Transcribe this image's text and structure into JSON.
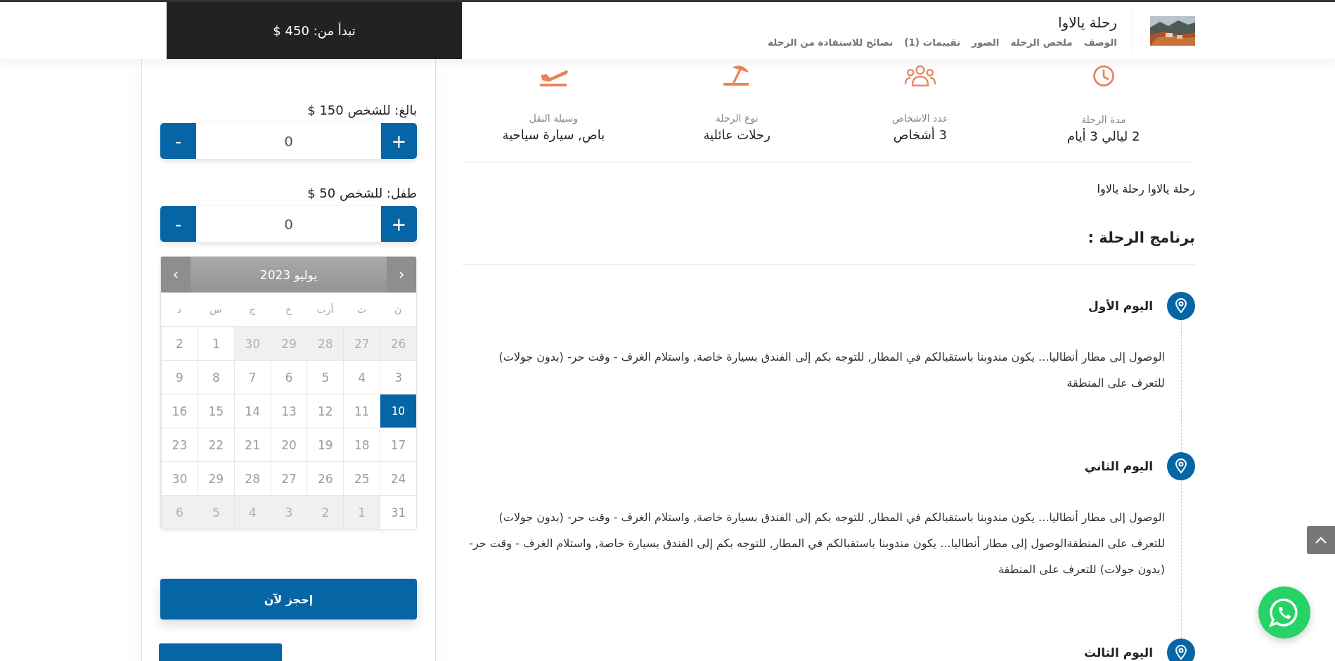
{
  "header": {
    "price": "تبدأ من: 450 $",
    "title": "رحلة يالاوا",
    "nav": [
      {
        "label": "الوصف"
      },
      {
        "label": "ملخص الرحلة"
      },
      {
        "label": "الصور"
      },
      {
        "label": "تقييمات (1)"
      },
      {
        "label": "نصائح للاستفادة من الرحلة"
      }
    ]
  },
  "info": [
    {
      "kind": "duration",
      "label": "مدة الرحلة",
      "value": "2 ليالي 3 أيام"
    },
    {
      "kind": "people",
      "label": "عدد الاشخاص",
      "value": "3 أشخاص"
    },
    {
      "kind": "type",
      "label": "نوع الرحلة",
      "value": "رحلات عائلية"
    },
    {
      "kind": "transport",
      "label": "وسيلة النقل",
      "value": "باص, سيارة سياحية"
    }
  ],
  "description": "رحلة يالاوا رحلة يالاوا",
  "program_title": "برنامج الرحلة :",
  "days": [
    {
      "title": "اليوم الأول",
      "text": "الوصول إلى مطار أنطاليا... يكون مندوبنا باستقبالكم في المطار, للتوجه بكم إلى الفندق بسيارة خاصة, واستلام الغرف - وقت حر- (بدون جولات) للتعرف على المنطقة"
    },
    {
      "title": "اليوم الثاني",
      "text": "الوصول إلى مطار أنطاليا... يكون مندوبنا باستقبالكم في المطار, للتوجه بكم إلى الفندق بسيارة خاصة, واستلام الغرف - وقت حر- (بدون جولات) للتعرف على المنطقةالوصول إلى مطار أنطاليا... يكون مندوبنا باستقبالكم في المطار, للتوجه بكم إلى الفندق بسيارة خاصة, واستلام الغرف - وقت حر- (بدون جولات) للتعرف على المنطقة"
    },
    {
      "title": "اليوم الثالث"
    }
  ],
  "booking": {
    "decrement": "-",
    "increment": "+",
    "tickets": [
      {
        "label": "بالغ: للشخص 150 $",
        "value": "0"
      },
      {
        "label": "طفل: للشخص 50 $",
        "value": "0"
      }
    ],
    "calendar": {
      "month": "يوليو 2023",
      "weekdays": [
        "ن",
        "ث",
        "أرب",
        "خ",
        "ج",
        "س",
        "د"
      ],
      "weeks": [
        [
          {
            "day": "26",
            "outside": true,
            "selected": false
          },
          {
            "day": "27",
            "outside": true,
            "selected": false
          },
          {
            "day": "28",
            "outside": true,
            "selected": false
          },
          {
            "day": "29",
            "outside": true,
            "selected": false
          },
          {
            "day": "30",
            "outside": true,
            "selected": false
          },
          {
            "day": "1",
            "outside": false,
            "selected": false
          },
          {
            "day": "2",
            "outside": false,
            "selected": false
          }
        ],
        [
          {
            "day": "3",
            "outside": false,
            "selected": false
          },
          {
            "day": "4",
            "outside": false,
            "selected": false
          },
          {
            "day": "5",
            "outside": false,
            "selected": false
          },
          {
            "day": "6",
            "outside": false,
            "selected": false
          },
          {
            "day": "7",
            "outside": false,
            "selected": false
          },
          {
            "day": "8",
            "outside": false,
            "selected": false
          },
          {
            "day": "9",
            "outside": false,
            "selected": false
          }
        ],
        [
          {
            "day": "10",
            "outside": false,
            "selected": true
          },
          {
            "day": "11",
            "outside": false,
            "selected": false
          },
          {
            "day": "12",
            "outside": false,
            "selected": false
          },
          {
            "day": "13",
            "outside": false,
            "selected": false
          },
          {
            "day": "14",
            "outside": false,
            "selected": false
          },
          {
            "day": "15",
            "outside": false,
            "selected": false
          },
          {
            "day": "16",
            "outside": false,
            "selected": false
          }
        ],
        [
          {
            "day": "17",
            "outside": false,
            "selected": false
          },
          {
            "day": "18",
            "outside": false,
            "selected": false
          },
          {
            "day": "19",
            "outside": false,
            "selected": false
          },
          {
            "day": "20",
            "outside": false,
            "selected": false
          },
          {
            "day": "21",
            "outside": false,
            "selected": false
          },
          {
            "day": "22",
            "outside": false,
            "selected": false
          },
          {
            "day": "23",
            "outside": false,
            "selected": false
          }
        ],
        [
          {
            "day": "24",
            "outside": false,
            "selected": false
          },
          {
            "day": "25",
            "outside": false,
            "selected": false
          },
          {
            "day": "26",
            "outside": false,
            "selected": false
          },
          {
            "day": "27",
            "outside": false,
            "selected": false
          },
          {
            "day": "28",
            "outside": false,
            "selected": false
          },
          {
            "day": "29",
            "outside": false,
            "selected": false
          },
          {
            "day": "30",
            "outside": false,
            "selected": false
          }
        ],
        [
          {
            "day": "31",
            "outside": false,
            "selected": false
          },
          {
            "day": "1",
            "outside": true,
            "selected": false
          },
          {
            "day": "2",
            "outside": true,
            "selected": false
          },
          {
            "day": "3",
            "outside": true,
            "selected": false
          },
          {
            "day": "4",
            "outside": true,
            "selected": false
          },
          {
            "day": "5",
            "outside": true,
            "selected": false
          },
          {
            "day": "6",
            "outside": true,
            "selected": false
          }
        ]
      ]
    },
    "book_button": "إحجز لآن"
  }
}
